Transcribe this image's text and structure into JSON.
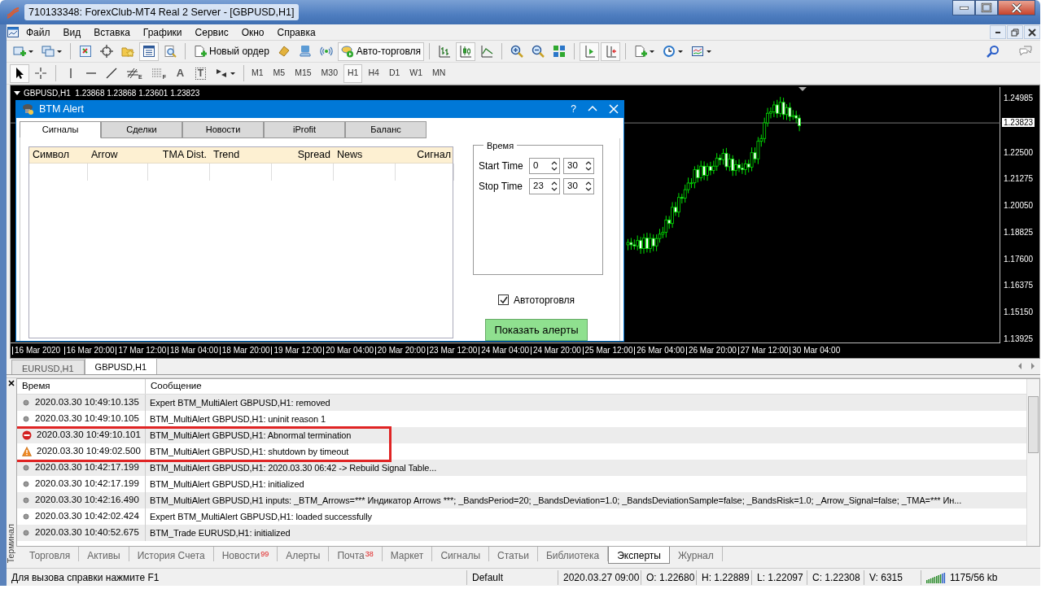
{
  "window": {
    "title": "710133348: ForexClub-MT4 Real 2 Server - [GBPUSD,H1]"
  },
  "menu": [
    {
      "label": "Файл"
    },
    {
      "label": "Вид"
    },
    {
      "label": "Вставка"
    },
    {
      "label": "Графики"
    },
    {
      "label": "Сервис"
    },
    {
      "label": "Окно"
    },
    {
      "label": "Справка"
    }
  ],
  "toolbar_main": {
    "items": [
      {
        "kind": "icon",
        "pressed": false,
        "dropdown": true
      },
      {
        "kind": "icon",
        "pressed": false,
        "dropdown": true
      },
      {
        "kind": "separator"
      },
      {
        "kind": "icon",
        "pressed": false
      },
      {
        "kind": "icon",
        "pressed": false
      },
      {
        "kind": "icon",
        "pressed": false
      },
      {
        "kind": "icon",
        "pressed": true
      },
      {
        "kind": "icon",
        "pressed": false
      },
      {
        "kind": "separator"
      },
      {
        "kind": "button",
        "label": "Новый ордер",
        "pressed": false
      },
      {
        "kind": "icon",
        "pressed": false
      },
      {
        "kind": "icon",
        "pressed": false
      },
      {
        "kind": "icon",
        "pressed": false
      },
      {
        "kind": "button",
        "label": "Авто-торговля",
        "pressed": true
      },
      {
        "kind": "separator"
      },
      {
        "kind": "icon",
        "pressed": false
      },
      {
        "kind": "icon",
        "pressed": true
      },
      {
        "kind": "icon",
        "pressed": false
      },
      {
        "kind": "separator"
      },
      {
        "kind": "icon",
        "pressed": false
      },
      {
        "kind": "icon",
        "pressed": false
      },
      {
        "kind": "icon",
        "pressed": false
      },
      {
        "kind": "separator"
      },
      {
        "kind": "icon",
        "pressed": true
      },
      {
        "kind": "icon",
        "pressed": true
      },
      {
        "kind": "separator"
      },
      {
        "kind": "icon",
        "pressed": false,
        "dropdown": true
      },
      {
        "kind": "icon",
        "pressed": false,
        "dropdown": true
      },
      {
        "kind": "icon",
        "pressed": false,
        "dropdown": true
      }
    ]
  },
  "toolbar_draw": {
    "items": [
      {
        "kind": "icon",
        "pressed": true
      },
      {
        "kind": "icon",
        "pressed": false
      },
      {
        "kind": "separator"
      },
      {
        "kind": "icon",
        "pressed": false
      },
      {
        "kind": "icon",
        "pressed": false
      },
      {
        "kind": "icon",
        "pressed": false
      },
      {
        "kind": "icon",
        "pressed": false,
        "label": "E"
      },
      {
        "kind": "icon",
        "pressed": false,
        "label": "F"
      },
      {
        "kind": "letter",
        "pressed": false,
        "label": "A"
      },
      {
        "kind": "boxed-letter",
        "pressed": false,
        "label": "T"
      },
      {
        "kind": "icon",
        "pressed": false,
        "dropdown": true
      },
      {
        "kind": "separator"
      }
    ],
    "timeframes": [
      {
        "label": "M1",
        "selected": false
      },
      {
        "label": "M5",
        "selected": false
      },
      {
        "label": "M15",
        "selected": false
      },
      {
        "label": "M30",
        "selected": false
      },
      {
        "label": "H1",
        "selected": true
      },
      {
        "label": "H4",
        "selected": false
      },
      {
        "label": "D1",
        "selected": false
      },
      {
        "label": "W1",
        "selected": false
      },
      {
        "label": "MN",
        "selected": false
      }
    ]
  },
  "chart": {
    "header": "GBPUSD,H1  1.23868 1.23868 1.23601 1.23823",
    "price_labels": [
      "1.24985",
      "1.22500",
      "1.21275",
      "1.20050",
      "1.18825",
      "1.17600",
      "1.16375",
      "1.15150",
      "1.13925"
    ],
    "current_price": "1.23823",
    "time_labels": [
      "16 Mar 2020",
      "16 Mar 20:00",
      "17 Mar 12:00",
      "18 Mar 04:00",
      "18 Mar 20:00",
      "19 Mar 12:00",
      "20 Mar 04:00",
      "20 Mar 20:00",
      "23 Mar 12:00",
      "24 Mar 04:00",
      "24 Mar 20:00",
      "25 Mar 12:00",
      "26 Mar 04:00",
      "26 Mar 20:00",
      "27 Mar 12:00",
      "30 Mar 04:00"
    ]
  },
  "dialog": {
    "title": "BTM Alert",
    "help_label": "?",
    "tabs": [
      {
        "label": "Сигналы",
        "selected": true
      },
      {
        "label": "Сделки",
        "selected": false
      },
      {
        "label": "Новости",
        "selected": false
      },
      {
        "label": "iProfit",
        "selected": false
      },
      {
        "label": "Баланс",
        "selected": false
      }
    ],
    "table": {
      "columns": [
        "Символ",
        "Arrow",
        "TMA Dist.",
        "Trend",
        "Spread",
        "News",
        "Сигнал"
      ]
    },
    "time_group": {
      "title": "Время",
      "rows": [
        {
          "label": "Start Time",
          "hours": "0",
          "minutes": "30"
        },
        {
          "label": "Stop Time",
          "hours": "23",
          "minutes": "30"
        }
      ]
    },
    "autotrade": {
      "label": "Автоторговля",
      "checked": true
    },
    "button": "Показать алерты"
  },
  "chart_tabs": [
    {
      "label": "EURUSD,H1",
      "selected": false
    },
    {
      "label": "GBPUSD,H1",
      "selected": true
    }
  ],
  "terminal": {
    "title": "Терминал",
    "columns": [
      "Время",
      "Сообщение"
    ],
    "rows": [
      {
        "kind": "info",
        "time": "2020.03.30 10:49:10.135",
        "message": "Expert BTM_MultiAlert GBPUSD,H1: removed",
        "highlighted": false
      },
      {
        "kind": "info",
        "time": "2020.03.30 10:49:10.105",
        "message": "BTM_MultiAlert GBPUSD,H1: uninit reason 1",
        "highlighted": false
      },
      {
        "kind": "error",
        "time": "2020.03.30 10:49:10.101",
        "message": "BTM_MultiAlert GBPUSD,H1: Abnormal termination",
        "highlighted": true
      },
      {
        "kind": "warning",
        "time": "2020.03.30 10:49:02.500",
        "message": "BTM_MultiAlert GBPUSD,H1: shutdown by timeout",
        "highlighted": true
      },
      {
        "kind": "info",
        "time": "2020.03.30 10:42:17.199",
        "message": "BTM_MultiAlert GBPUSD,H1: 2020.03.30 06:42 -> Rebuild Signal Table...",
        "highlighted": false
      },
      {
        "kind": "info",
        "time": "2020.03.30 10:42:17.199",
        "message": "BTM_MultiAlert GBPUSD,H1: initialized",
        "highlighted": false
      },
      {
        "kind": "info",
        "time": "2020.03.30 10:42:16.490",
        "message": "BTM_MultiAlert GBPUSD,H1 inputs: _BTM_Arrows=*** Индикатор Arrows ***; _BandsPeriod=20; _BandsDeviation=1.0; _BandsDeviationSample=false; _BandsRisk=1.0; _Arrow_Signal=false; _TMA=*** Ин...",
        "highlighted": false
      },
      {
        "kind": "info",
        "time": "2020.03.30 10:42:02.424",
        "message": "Expert BTM_MultiAlert GBPUSD,H1: loaded successfully",
        "highlighted": false
      },
      {
        "kind": "info",
        "time": "2020.03.30 10:40:52.675",
        "message": "BTM_Trade EURUSD,H1: initialized",
        "highlighted": false
      }
    ],
    "tabs": [
      {
        "label": "Торговля",
        "selected": false
      },
      {
        "label": "Активы",
        "selected": false
      },
      {
        "label": "История Счета",
        "selected": false
      },
      {
        "label": "Новости",
        "badge": "99",
        "selected": false
      },
      {
        "label": "Алерты",
        "selected": false
      },
      {
        "label": "Почта",
        "badge": "38",
        "selected": false
      },
      {
        "label": "Маркет",
        "selected": false
      },
      {
        "label": "Сигналы",
        "selected": false
      },
      {
        "label": "Статьи",
        "selected": false
      },
      {
        "label": "Библиотека",
        "selected": false
      },
      {
        "label": "Эксперты",
        "selected": true
      },
      {
        "label": "Журнал",
        "selected": false
      }
    ]
  },
  "status_bar": [
    "Для вызова справки нажмите F1",
    "Default",
    "2020.03.27 09:00",
    "O: 1.22680",
    "H: 1.22889",
    "L: 1.22097",
    "C: 1.22308",
    "V: 6315",
    "1175/56 kb"
  ]
}
